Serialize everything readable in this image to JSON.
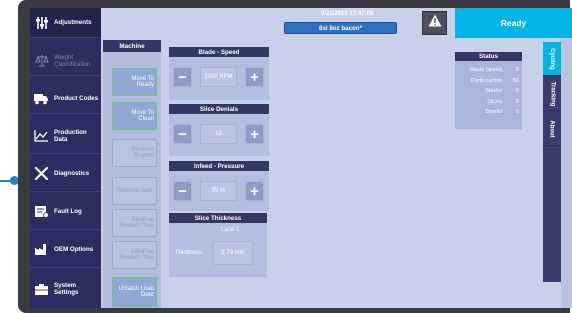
{
  "sidebar": {
    "items": [
      {
        "label": "Adjustments",
        "icon": "sliders-icon",
        "state": "active"
      },
      {
        "label": "Weight Classification",
        "icon": "scale-icon",
        "state": "disabled"
      },
      {
        "label": "Product Codes",
        "icon": "truck-icon",
        "state": "normal"
      },
      {
        "label": "Production Data",
        "icon": "line-chart-icon",
        "state": "normal"
      },
      {
        "label": "Diagnostics",
        "icon": "tools-icon",
        "state": "normal"
      },
      {
        "label": "Fault Log",
        "icon": "fault-log-icon",
        "state": "normal"
      },
      {
        "label": "OEM Options",
        "icon": "factory-icon",
        "state": "normal"
      },
      {
        "label": "System Settings",
        "icon": "settings-icon",
        "state": "normal"
      }
    ]
  },
  "header": {
    "datetime": "9/21/2019  17:47:08",
    "product": "8sl 8oz bacon*",
    "alarm_icon": "warning-triangle-icon",
    "status_label": "Ready",
    "accent_color": "#00b5e5"
  },
  "machine": {
    "title": "Machine",
    "buttons": [
      {
        "label": "Move To Ready",
        "enabled": true
      },
      {
        "label": "Move To Clean",
        "enabled": true
      },
      {
        "label": "Remove Product",
        "enabled": false
      },
      {
        "label": "Remove Jam",
        "enabled": false
      },
      {
        "label": "Reverse Product Tray",
        "enabled": false
      },
      {
        "label": "Advance Product Tray",
        "enabled": false
      },
      {
        "label": "Unlatch Load Door",
        "enabled": true
      }
    ]
  },
  "controls": {
    "blade_speed": {
      "title": "Blade - Speed",
      "value": "1000 RPM",
      "minus": "−",
      "plus": "+"
    },
    "slice_denials": {
      "title": "Slice Denials",
      "value": "10",
      "minus": "−",
      "plus": "+"
    },
    "infeed_pressure": {
      "title": "Infeed - Pressure",
      "value": "35 %",
      "minus": "−",
      "plus": "+"
    },
    "slice_thickness": {
      "title": "Slice Thickness",
      "lane": "Lane 1",
      "label": "Thickness:",
      "value": "2.79 mm"
    }
  },
  "status": {
    "title": "Status",
    "rows": [
      {
        "label": "Blade Speed",
        "value": "0"
      },
      {
        "label": "Portions/min",
        "value": "55"
      },
      {
        "label": "Stacks",
        "value": "0"
      },
      {
        "label": "Slices",
        "value": "0"
      },
      {
        "label": "Dwells",
        "value": "0"
      }
    ]
  },
  "right_tabs": [
    {
      "label": "Cycling",
      "active": true
    },
    {
      "label": "Tracking",
      "active": false
    },
    {
      "label": "About",
      "active": false
    }
  ]
}
